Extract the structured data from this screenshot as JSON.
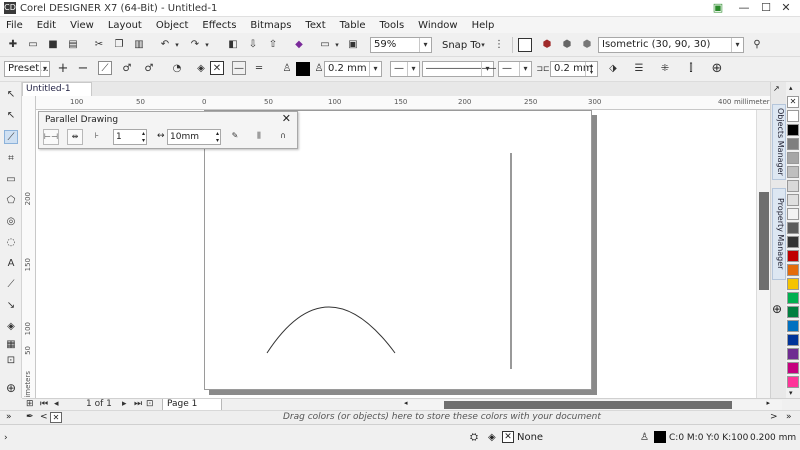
{
  "window": {
    "title": "Corel DESIGNER X7 (64-Bit) - Untitled-1",
    "app_icon": "CD",
    "minimize": "—",
    "maximize": "☐",
    "close": "✕"
  },
  "menu": [
    "File",
    "Edit",
    "View",
    "Layout",
    "Object",
    "Effects",
    "Bitmaps",
    "Text",
    "Table",
    "Tools",
    "Window",
    "Help"
  ],
  "toolbar1": {
    "zoom": "59%",
    "snap_to": "Snap To",
    "projection": "Isometric (30, 90, 30)"
  },
  "toolbar2": {
    "preset": "Preset...",
    "outline_width": "0.2 mm",
    "offset": "0.2 mm"
  },
  "document": {
    "tab_label": "Untitled-1"
  },
  "ruler": {
    "top_labels": [
      "100",
      "50",
      "0",
      "50",
      "100",
      "150",
      "200",
      "250",
      "300",
      "400"
    ],
    "top_unit": "millimeters",
    "left_labels": [
      "200",
      "150",
      "100",
      "50"
    ],
    "left_unit": "millimeters"
  },
  "parallel_drawing": {
    "title": "Parallel Drawing",
    "close": "✕",
    "line_count": "1",
    "distance": "10mm"
  },
  "dockers": {
    "objects_manager": "Objects Manager",
    "property_manager": "Property Manager"
  },
  "palette_colors": [
    "#ffffff",
    "#000000",
    "#7f7f7f",
    "#a6a6a6",
    "#bfbfbf",
    "#d9d9d9",
    "#e0e0e0",
    "#f2f2f2",
    "#5b5b5b",
    "#333333",
    "#c00000",
    "#e46c0a",
    "#f5c400",
    "#00b050",
    "#007f3f",
    "#0070c0",
    "#003399",
    "#6f2c91",
    "#c5007f",
    "#ff3399"
  ],
  "pagebar": {
    "page_of": "1 of 1",
    "page_tab": "Page 1"
  },
  "hint": "Drag colors (or objects) here to store these colors with your document",
  "status": {
    "fill": "None",
    "outline_color": "C:0 M:0 Y:0 K:100",
    "outline_width": "0.200 mm"
  }
}
